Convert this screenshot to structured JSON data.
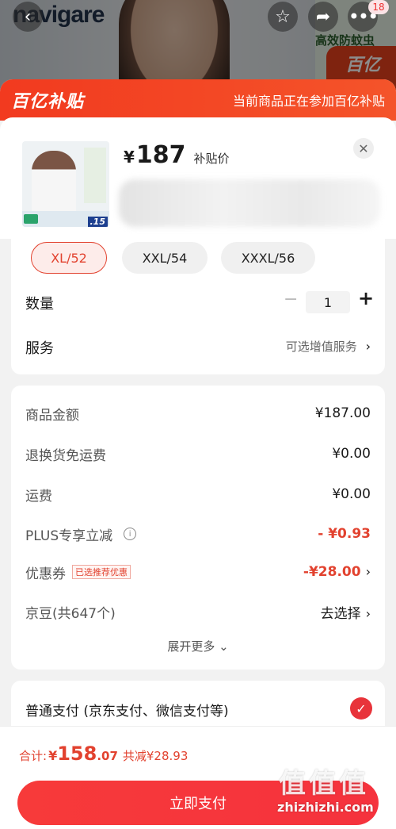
{
  "background": {
    "brand": "navigare",
    "side_text": "高效防蚊虫",
    "badge_text": "百亿",
    "cart_count": "18"
  },
  "banner": {
    "logo": "百亿补贴",
    "note": "当前商品正在参加百亿补贴"
  },
  "product": {
    "currency": "¥",
    "price": "187",
    "price_label": "补贴价",
    "thumb_price": ".15"
  },
  "sizes": [
    {
      "label": "XL/52",
      "selected": true
    },
    {
      "label": "XXL/54",
      "selected": false
    },
    {
      "label": "XXXL/56",
      "selected": false
    }
  ],
  "quantity": {
    "label": "数量",
    "minus": "−",
    "value": "1",
    "plus": "+"
  },
  "service": {
    "label": "服务",
    "link": "可选增值服务",
    "arrow": "›"
  },
  "fees": {
    "goods_amount": {
      "label": "商品金额",
      "value": "¥187.00"
    },
    "return_shipping": {
      "label": "退换货免运费",
      "value": "¥0.00"
    },
    "shipping": {
      "label": "运费",
      "value": "¥0.00"
    },
    "plus": {
      "label": "PLUS专享立减",
      "value": "- ¥0.93"
    },
    "coupon": {
      "label": "优惠券",
      "tag": "已选推荐优惠",
      "value": "-¥28.00"
    },
    "jingdou": {
      "label": "京豆(共647个)",
      "value": "去选择"
    },
    "expand": "展开更多 ⌄"
  },
  "payment": {
    "label": "普通支付 (京东支付、微信支付等)"
  },
  "footer": {
    "total_label": "合计:",
    "currency": "¥",
    "total_int": "158",
    "total_dec": ".07",
    "saved": "共减¥28.93",
    "pay_button": "立即支付"
  },
  "watermark": {
    "main": "值值值",
    "sub": "zhizhizhi.com"
  },
  "colors": {
    "accent_red": "#e2422f",
    "banner_red": "#f23a1f",
    "pay_button": "#f5323d"
  }
}
